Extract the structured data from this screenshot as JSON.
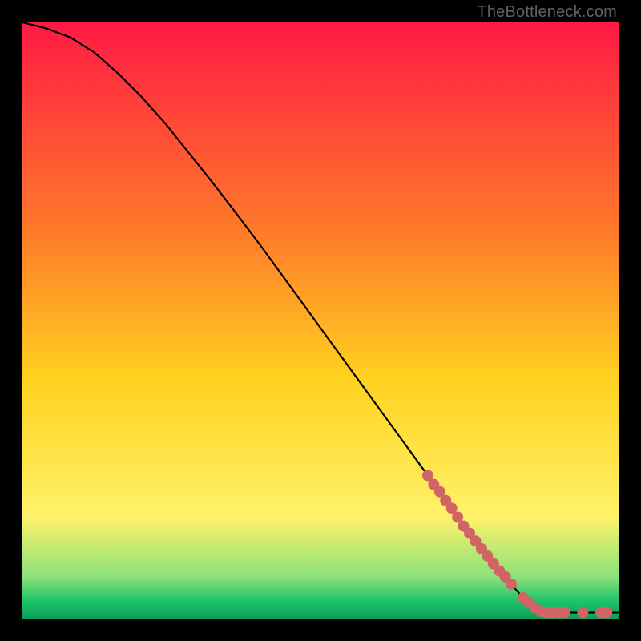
{
  "watermark": {
    "text": "TheBottleneck.com"
  },
  "colors": {
    "black": "#000000",
    "curve": "#000000",
    "marker": "#d16464",
    "grad_top": "#ff1a44",
    "grad_mid_upper": "#ff7a2a",
    "grad_mid": "#ffd21f",
    "grad_mid_lower": "#fff26a",
    "grad_green_a": "#8be27a",
    "grad_green_b": "#20c46a",
    "grad_bottom": "#0aa05a"
  },
  "chart_data": {
    "type": "line",
    "title": "",
    "xlabel": "",
    "ylabel": "",
    "xlim": [
      0,
      100
    ],
    "ylim": [
      0,
      100
    ],
    "grid": false,
    "legend": false,
    "series": [
      {
        "name": "curve",
        "x": [
          0,
          4,
          8,
          12,
          16,
          20,
          24,
          28,
          32,
          36,
          40,
          44,
          48,
          52,
          56,
          60,
          64,
          68,
          72,
          76,
          80,
          84,
          88,
          92,
          96,
          100
        ],
        "y": [
          100,
          99,
          97.5,
          95,
          91.5,
          87.5,
          83,
          78,
          73,
          67.8,
          62.5,
          57,
          51.5,
          46,
          40.5,
          35,
          29.5,
          24,
          18.5,
          13,
          8,
          3.5,
          1,
          1,
          1,
          1
        ]
      },
      {
        "name": "markers",
        "x": [
          68,
          69,
          70,
          71,
          72,
          73,
          74,
          75,
          76,
          77,
          78,
          79,
          80,
          81,
          82,
          84,
          85,
          86,
          87,
          88,
          89,
          90,
          91,
          94,
          97,
          98
        ],
        "y": [
          24,
          22.5,
          21.3,
          19.8,
          18.5,
          17,
          15.5,
          14.3,
          13,
          11.7,
          10.5,
          9.2,
          8,
          7,
          5.8,
          3.5,
          2.7,
          1.8,
          1.2,
          1,
          1,
          1,
          1,
          1,
          1,
          1
        ]
      }
    ]
  }
}
